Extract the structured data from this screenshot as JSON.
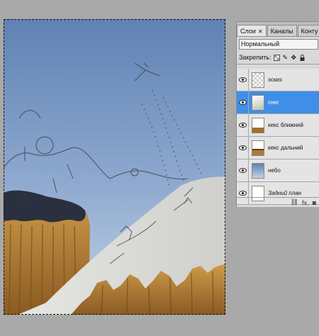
{
  "layers_panel": {
    "tabs": [
      {
        "label": "Слои",
        "active": true,
        "closable": true
      },
      {
        "label": "Каналы",
        "active": false,
        "closable": false
      },
      {
        "label": "Конту",
        "active": false,
        "closable": false
      }
    ],
    "blend_mode": "Нормальный",
    "lock_label": "Закрепить:",
    "layers": [
      {
        "name": "эскиз",
        "visible": true,
        "selected": false,
        "thumb": "check"
      },
      {
        "name": "снег",
        "visible": true,
        "selected": true,
        "thumb": "snow"
      },
      {
        "name": "кекс ближний",
        "visible": true,
        "selected": false,
        "thumb": "cake"
      },
      {
        "name": "кекс дальний",
        "visible": true,
        "selected": false,
        "thumb": "cake2"
      },
      {
        "name": "небо",
        "visible": true,
        "selected": false,
        "thumb": "sky"
      },
      {
        "name": "Задний план",
        "visible": true,
        "selected": false,
        "thumb": "white",
        "italic": true
      }
    ],
    "footer_icons": [
      "link-icon",
      "fx-icon",
      "mask-icon"
    ],
    "footer_fx_label": "fx."
  },
  "colors": {
    "workspace": "#a9a9a9",
    "sky_top": "#5e81b3",
    "sky_bottom": "#b9cde3",
    "snow": "#dcdcd8",
    "cake": "#b5853a",
    "selected_layer": "#3f8ee8"
  }
}
